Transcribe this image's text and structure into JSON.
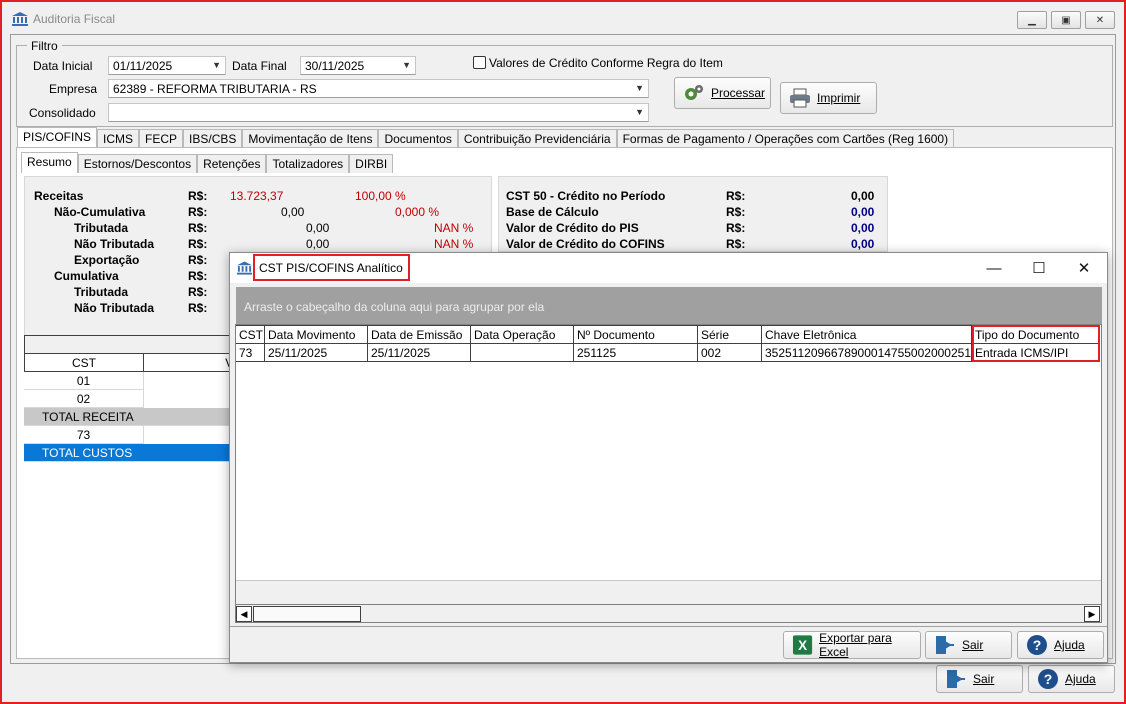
{
  "window": {
    "title": "Auditoria Fiscal"
  },
  "filter": {
    "group_label": "Filtro",
    "date_start_label": "Data Inicial",
    "date_start_value": "01/11/2025",
    "date_end_label": "Data Final",
    "date_end_value": "30/11/2025",
    "credit_rule_checkbox": "Valores de Crédito Conforme Regra do Item",
    "company_label": "Empresa",
    "company_value": "62389 - REFORMA TRIBUTARIA - RS",
    "consolidated_label": "Consolidado",
    "consolidated_value": ""
  },
  "buttons": {
    "process": "Processar",
    "print": "Imprimir",
    "exit": "Sair",
    "help": "Ajuda"
  },
  "main_tabs": [
    "PIS/COFINS",
    "ICMS",
    "FECP",
    "IBS/CBS",
    "Movimentação de Itens",
    "Documentos",
    "Contribuição Previdenciária",
    "Formas de Pagamento / Operações com Cartões  (Reg 1600)"
  ],
  "sub_tabs": [
    "Resumo",
    "Estornos/Descontos",
    "Retenções",
    "Totalizadores",
    "DIRBI"
  ],
  "summary_left": {
    "currency": "R$:",
    "rows": [
      {
        "label": "Receitas",
        "value": "13.723,37",
        "pct": "100,00 %"
      },
      {
        "label": "Não-Cumulativa",
        "value": "0,00",
        "pct": "0,000 %"
      },
      {
        "label": "Tributada",
        "value": "0,00",
        "pct": "NAN %"
      },
      {
        "label": "Não Tributada",
        "value": "0,00",
        "pct": "NAN %"
      },
      {
        "label": "Exportação",
        "value": "",
        "pct": ""
      },
      {
        "label": "Cumulativa",
        "value": "",
        "pct": ""
      },
      {
        "label": "Tributada",
        "value": "",
        "pct": ""
      },
      {
        "label": "Não Tributada",
        "value": "",
        "pct": ""
      }
    ]
  },
  "summary_right": {
    "currency": "R$:",
    "rows": [
      {
        "label": "CST 50 - Crédito no Período",
        "value": "0,00"
      },
      {
        "label": "Base de Cálculo",
        "value": "0,00"
      },
      {
        "label": "Valor de Crédito do PIS",
        "value": "0,00"
      },
      {
        "label": "Valor de Crédito do COFINS",
        "value": "0,00"
      }
    ]
  },
  "cst_grid": {
    "headers": [
      "CST",
      "Va"
    ],
    "rows": [
      {
        "cst": "01"
      },
      {
        "cst": "02"
      },
      {
        "cst": "TOTAL RECEITA"
      },
      {
        "cst": "73"
      },
      {
        "cst": "TOTAL CUSTOS"
      }
    ]
  },
  "dialog": {
    "title": "CST PIS/COFINS Analítico",
    "group_hint": "Arraste o cabeçalho da coluna aqui para agrupar por ela",
    "columns": [
      "CST",
      "Data Movimento",
      "Data de Emissão",
      "Data Operação",
      "Nº Documento",
      "Série",
      "Chave Eletrônica",
      "Tipo do Documento"
    ],
    "rows": [
      {
        "cst": "73",
        "data_movimento": "25/11/2025",
        "data_emissao": "25/11/2025",
        "data_operacao": "",
        "numero": "251125",
        "serie": "002",
        "chave": "35251120966789000147550020002511251",
        "tipo": "Entrada ICMS/IPI"
      }
    ],
    "export_button": "Exportar para Excel",
    "exit_button": "Sair",
    "help_button": "Ajuda"
  }
}
